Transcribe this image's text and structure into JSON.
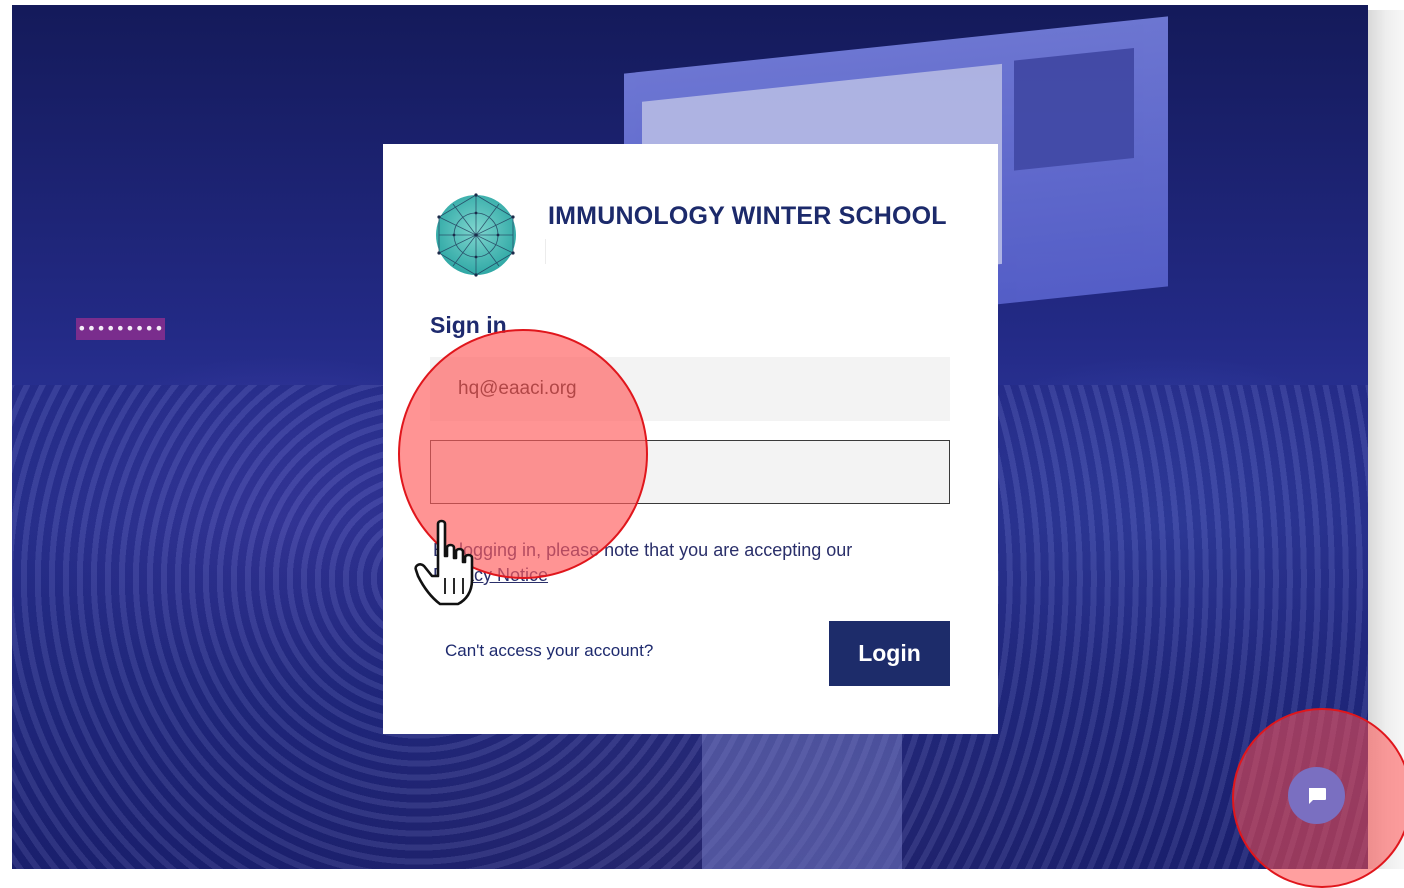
{
  "brand": {
    "title": "IMMUNOLOGY WINTER SCHOOL",
    "logo_icon": "network-globe-icon"
  },
  "login": {
    "heading": "Sign in",
    "email_value": "hq@eaaci.org",
    "password_mask": "•••••••••",
    "notice_text": "By logging in, please note that you are accepting our",
    "notice_link": "Privacy Notice",
    "cant_access_label": "Can't access your account?",
    "login_button": "Login"
  },
  "chat": {
    "icon": "chat-bubble-icon"
  },
  "colors": {
    "brand_navy": "#1d2c6a",
    "highlight_red": "#e0161c",
    "chat_purple": "#7a6fc1"
  }
}
